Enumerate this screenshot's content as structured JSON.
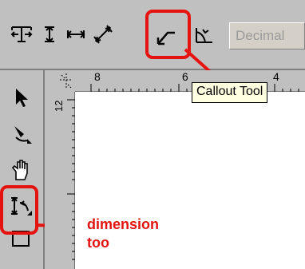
{
  "toolbar": {
    "icons": [
      "text-dimension-icon",
      "vertical-dimension-icon",
      "horizontal-dimension-icon",
      "slanted-dimension-icon",
      "callout-tool-icon",
      "angular-dimension-icon"
    ],
    "units_value": "Decimal"
  },
  "tooltip": {
    "text": "Callout Tool"
  },
  "rulers": {
    "top_labels": [
      "8",
      "6",
      "4"
    ],
    "left_labels": [
      "12"
    ]
  },
  "toolbox": {
    "tools": [
      "pick-tool-icon",
      "shape-tool-icon",
      "pan-tool-icon",
      "dimension-tool-icon",
      "rectangle-tool-icon"
    ]
  },
  "annotation": {
    "label_line1": "dimension",
    "label_line2": "too",
    "color": "#e5120f"
  }
}
